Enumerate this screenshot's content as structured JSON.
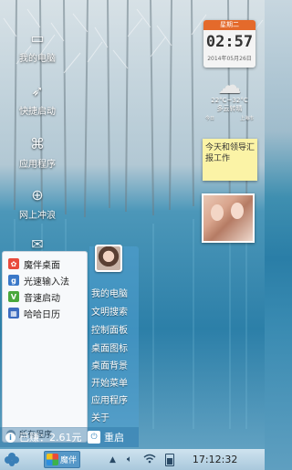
{
  "desktop": {
    "icons": [
      {
        "label": "我的电脑",
        "icon": "computer-icon",
        "glyph": "▭"
      },
      {
        "label": "快捷启动",
        "icon": "rocket-icon",
        "glyph": "➶"
      },
      {
        "label": "应用程序",
        "icon": "apps-icon",
        "glyph": "⌘"
      },
      {
        "label": "网上冲浪",
        "icon": "globe-icon",
        "glyph": "⊕"
      },
      {
        "label": "",
        "icon": "mail-icon",
        "glyph": "✉"
      }
    ]
  },
  "widgets": {
    "clock": {
      "weekday": "星期二",
      "time": "02:57",
      "date": "2014年05月26日"
    },
    "weather": {
      "temp": "22°C~32°C",
      "condition": "多云转晴",
      "today": "今日",
      "city": "上海市"
    },
    "note": {
      "text": "今天和领导汇报工作"
    }
  },
  "start_menu": {
    "apps": [
      {
        "label": "魔伴桌面",
        "icon": "magic-desktop-icon",
        "color": "#e84a3c",
        "glyph": "✿"
      },
      {
        "label": "光速输入法",
        "icon": "keyboard-icon",
        "color": "#3a78c8",
        "glyph": "g"
      },
      {
        "label": "音速启动",
        "icon": "launcher-icon",
        "color": "#4aa83c",
        "glyph": "V"
      },
      {
        "label": "哈哈日历",
        "icon": "calendar-icon",
        "color": "#3d6cbf",
        "glyph": "▦"
      }
    ],
    "all_programs": "所有程序",
    "links": [
      "我的电脑",
      "文明搜索",
      "控制面板",
      "桌面图标",
      "桌面背景",
      "开始菜单",
      "应用程序",
      "关于"
    ],
    "earned": "已赚：2.61元",
    "restart": "重启"
  },
  "taskbar": {
    "task_label": "魔伴",
    "time": "17:12:32"
  },
  "colors": {
    "accent": "#5698c8",
    "clock_header": "#e46a2b",
    "note_bg": "#fbf3a6"
  }
}
